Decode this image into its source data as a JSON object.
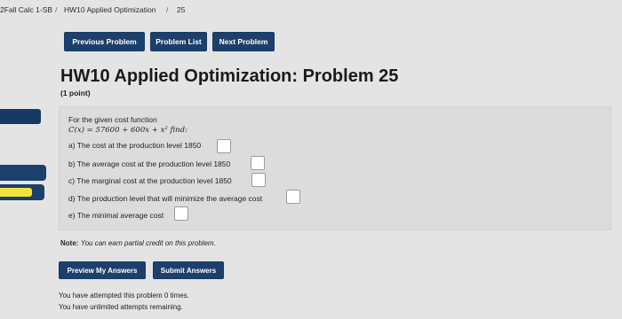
{
  "breadcrumb": {
    "course": "2Fall Calc 1-SB",
    "separator": "/",
    "set": "HW10 Applied Optimization",
    "problem": "25"
  },
  "nav": {
    "previous": "Previous Problem",
    "list": "Problem List",
    "next": "Next Problem"
  },
  "problem": {
    "title": "HW10 Applied Optimization: Problem 25",
    "points": "(1 point)",
    "intro": "For the given cost function",
    "function": "C(x) = 57600 + 600x + x² find:",
    "parts": [
      "a) The cost at the production level 1850",
      "b) The average cost at the production level 1850",
      "c) The marginal cost at the production level 1850",
      "d) The production level that will minimize the average cost",
      "e) The minimal average cost"
    ]
  },
  "note": {
    "label": "Note:",
    "text": "You can earn partial credit on this problem."
  },
  "actions": {
    "preview": "Preview My Answers",
    "submit": "Submit Answers"
  },
  "attempts": {
    "line1": "You have attempted this problem 0 times.",
    "line2": "You have unlimited attempts remaining."
  },
  "colors": {
    "button": "#1d3f6b",
    "background": "#e4e4e4",
    "accent": "#efe53a"
  }
}
